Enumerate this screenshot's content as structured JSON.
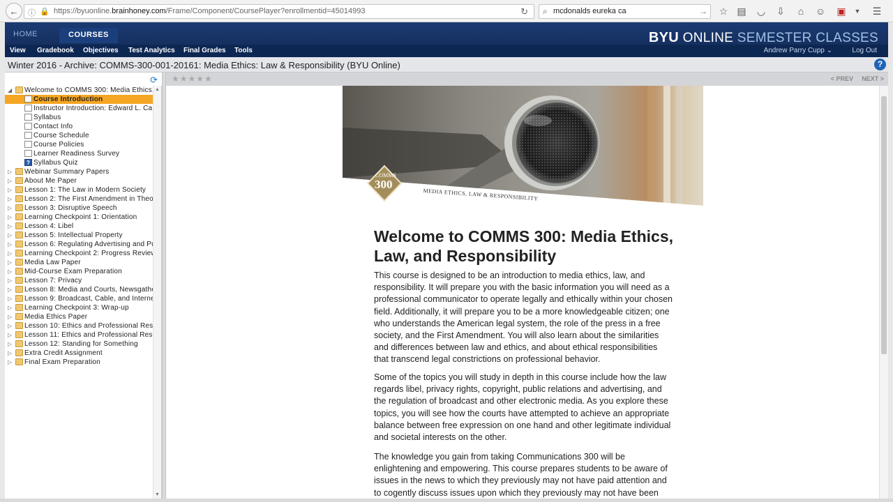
{
  "browser": {
    "url_prefix": "https://byuonline.",
    "url_domain": "brainhoney.com",
    "url_path": "/Frame/Component/CoursePlayer?enrollmentid=45014993",
    "search_query": "mcdonalds eureka ca"
  },
  "header": {
    "home_tab": "HOME",
    "courses_tab": "COURSES",
    "brand_byu": "BYU",
    "brand_online": "ONLINE",
    "brand_semester": "SEMESTER CLASSES"
  },
  "subnav": {
    "view": "View",
    "gradebook": "Gradebook",
    "objectives": "Objectives",
    "test_analytics": "Test Analytics",
    "final_grades": "Final Grades",
    "tools": "Tools",
    "user": "Andrew Parry Cupp",
    "logout": "Log Out"
  },
  "title_bar": {
    "title": "Winter 2016 - Archive: COMMS-300-001-20161: Media Ethics: Law & Responsibility (BYU Online)"
  },
  "content_nav": {
    "stars": "★★★★★",
    "prev": "< PREV",
    "next": "NEXT >"
  },
  "tree": {
    "root": "Welcome to COMMS 300: Media Ethics,",
    "children": [
      {
        "label": "Course Introduction",
        "type": "doc"
      },
      {
        "label": "Instructor Introduction: Edward L. Ca",
        "type": "doc"
      },
      {
        "label": "Syllabus",
        "type": "doc"
      },
      {
        "label": "Contact Info",
        "type": "doc"
      },
      {
        "label": "Course Schedule",
        "type": "doc"
      },
      {
        "label": "Course Policies",
        "type": "doc"
      },
      {
        "label": "Learner Readiness Survey",
        "type": "doc"
      },
      {
        "label": "Syllabus Quiz",
        "type": "quiz"
      }
    ],
    "folders": [
      "Webinar Summary Papers",
      "About Me Paper",
      "Lesson 1: The Law in Modern Society",
      "Lesson 2: The First Amendment in Theo",
      "Lesson 3: Disruptive Speech",
      "Learning Checkpoint 1: Orientation",
      "Lesson 4: Libel",
      "Lesson 5: Intellectual Property",
      "Lesson 6: Regulating Advertising and Pu",
      "Learning Checkpoint 2: Progress Review",
      "Media Law Paper",
      "Mid-Course Exam Preparation",
      "Lesson 7: Privacy",
      "Lesson 8: Media and Courts, Newsgathe",
      "Lesson 9: Broadcast, Cable, and Interne",
      "Learning Checkpoint 3: Wrap-up",
      "Media Ethics Paper",
      "Lesson 10: Ethics and Professional Resp",
      "Lesson 11: Ethics and Professional Resp",
      "Lesson 12: Standing for Something",
      "Extra Credit Assignment",
      "Final Exam Preparation"
    ]
  },
  "banner": {
    "badge_top": "COMMS",
    "badge_num": "300",
    "caption": "MEDIA ETHICS, LAW & RESPONSIBILITY"
  },
  "main": {
    "heading": "Welcome to COMMS 300: Media Ethics, Law, and Responsibility",
    "p1": "This course is designed to be an introduction to media ethics, law, and responsibility. It will prepare you with the basic information you will need as a professional communicator to operate legally and ethically within your chosen field. Additionally, it will prepare you to be a more knowledgeable citizen; one who understands the American legal system, the role of the press in a free society, and the First Amendment. You will also learn about the similarities and differences between law and ethics, and about ethical responsibilities that transcend legal constrictions on professional behavior.",
    "p2": "Some of the topics you will study in depth in this course include how the law regards libel, privacy rights, copyright, public relations and advertising, and the regulation of broadcast and other electronic media. As you explore these topics, you will see how the courts have attempted to achieve an appropriate balance between free expression on one hand and other legitimate individual and societal interests on the other.",
    "p3": "The knowledge you gain from taking Communications 300 will be enlightening and empowering. This course prepares students to be aware of issues in the news to which they previously may not have paid attention and to cogently discuss issues upon which they previously may not have been"
  },
  "colors": {
    "header_blue": "#1c3a73",
    "subnav_blue": "#0d2753",
    "active_item": "#f5a623"
  }
}
